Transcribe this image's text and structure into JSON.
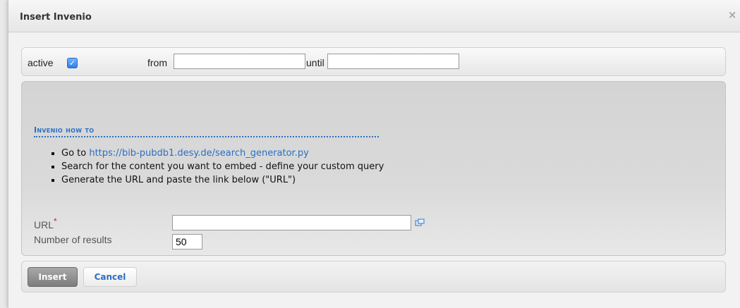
{
  "dialog": {
    "title": "Insert Invenio",
    "close_glyph": "×"
  },
  "settings": {
    "active_label": "active",
    "active_checked": true,
    "checkbox_glyph": "✓",
    "from_label": "from",
    "from_value": "",
    "until_label": "until",
    "until_value": ""
  },
  "howto": {
    "heading": "Invenio how to",
    "steps": [
      {
        "prefix": "Go to ",
        "link": "https://bib-pubdb1.desy.de/search_generator.py"
      },
      {
        "text": "Search for the content you want to embed - define your custom query"
      },
      {
        "text": "Generate the URL and paste the link below (\"URL\")"
      }
    ]
  },
  "form": {
    "url_label": "URL",
    "url_required_mark": "*",
    "url_value": "",
    "results_label": "Number of results",
    "results_value": "50"
  },
  "buttons": {
    "insert_label": "Insert",
    "cancel_label": "Cancel"
  },
  "colors": {
    "accent": "#2b6fc4",
    "required": "#d0202a",
    "checkbox": "#2f7ee8"
  },
  "icons": {
    "close": "close-icon",
    "checkbox": "checkmark-icon",
    "url_browse": "popup-window-icon"
  }
}
